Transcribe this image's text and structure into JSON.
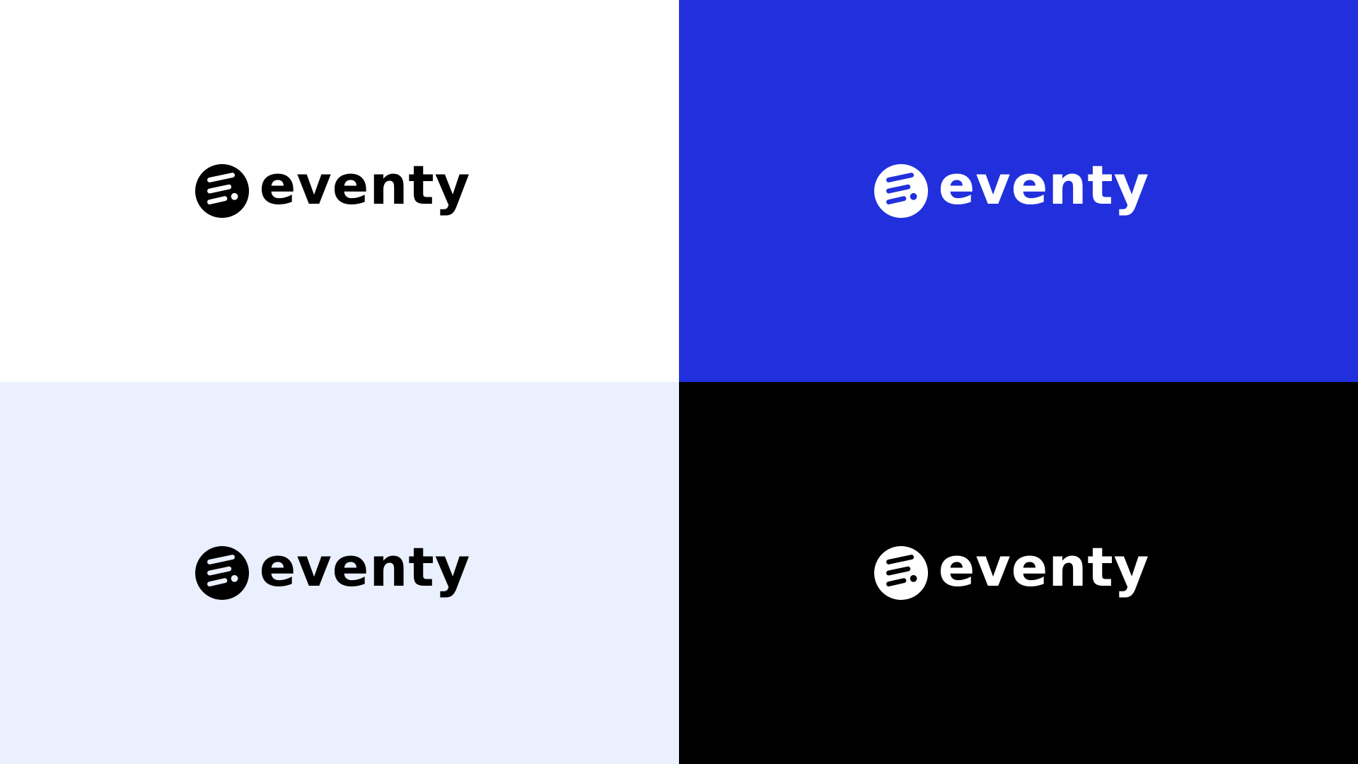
{
  "brand": {
    "name": "eventy"
  },
  "panels": [
    {
      "id": "white",
      "background": "#ffffff",
      "foreground": "#000000",
      "stripe": "#ffffff"
    },
    {
      "id": "blue",
      "background": "#2130dc",
      "foreground": "#ffffff",
      "stripe": "#2130dc"
    },
    {
      "id": "light-blue",
      "background": "#eaf0fd",
      "foreground": "#000000",
      "stripe": "#eaf0fd"
    },
    {
      "id": "black",
      "background": "#000000",
      "foreground": "#ffffff",
      "stripe": "#000000"
    }
  ],
  "icons": {
    "mark": "eventy-logo-mark-icon"
  }
}
